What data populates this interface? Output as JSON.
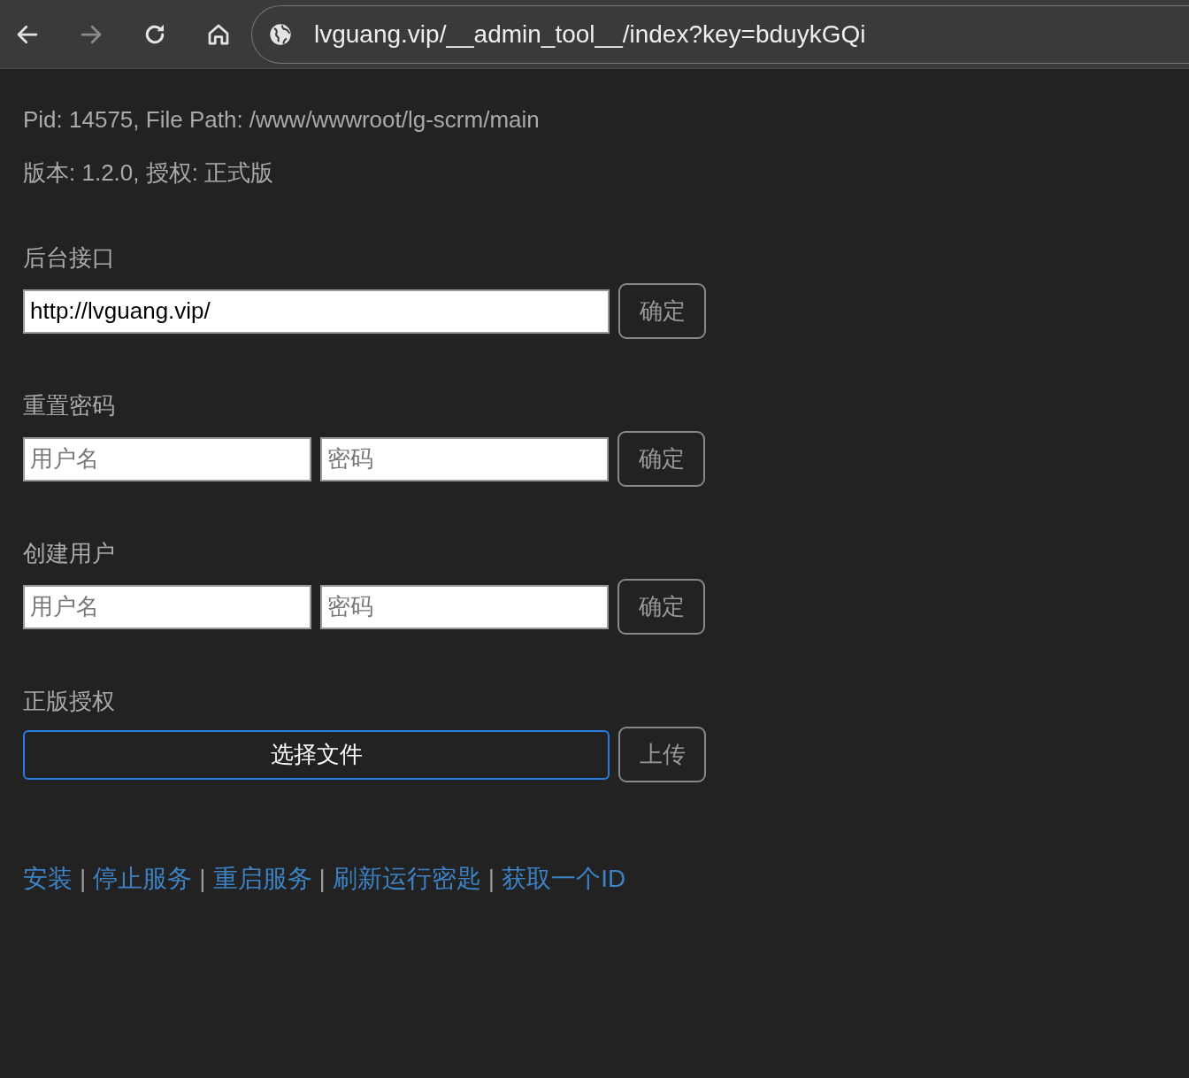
{
  "browser": {
    "back_disabled": false,
    "forward_disabled": true,
    "url": "lvguang.vip/__admin_tool__/index?key=bduykGQi"
  },
  "info_lines": [
    "Pid: 14575, File Path: /www/wwwroot/lg-scrm/main",
    "版本: 1.2.0, 授权: 正式版"
  ],
  "sections": [
    {
      "title": "后台接口",
      "fields": [
        {
          "kind": "input",
          "value": "http://lvguang.vip/"
        }
      ],
      "button": "确定"
    },
    {
      "title": "重置密码",
      "fields": [
        {
          "kind": "input",
          "placeholder": "用户名"
        },
        {
          "kind": "input",
          "placeholder": "密码"
        }
      ],
      "button": "确定"
    },
    {
      "title": "创建用户",
      "fields": [
        {
          "kind": "input",
          "placeholder": "用户名"
        },
        {
          "kind": "input",
          "placeholder": "密码"
        }
      ],
      "button": "确定"
    },
    {
      "title": "正版授权",
      "fields": [
        {
          "kind": "file",
          "label": "选择文件",
          "focused": true
        }
      ],
      "button": "上传"
    }
  ],
  "footer": [
    {
      "kind": "link",
      "text": "安装"
    },
    {
      "kind": "separator",
      "text": "|"
    },
    {
      "kind": "link",
      "text": "停止服务"
    },
    {
      "kind": "separator",
      "text": "|"
    },
    {
      "kind": "link",
      "text": "重启服务"
    },
    {
      "kind": "separator",
      "text": "|"
    },
    {
      "kind": "link",
      "text": "刷新运行密匙"
    },
    {
      "kind": "separator",
      "text": "|"
    },
    {
      "kind": "link",
      "text": "获取一个ID"
    }
  ]
}
